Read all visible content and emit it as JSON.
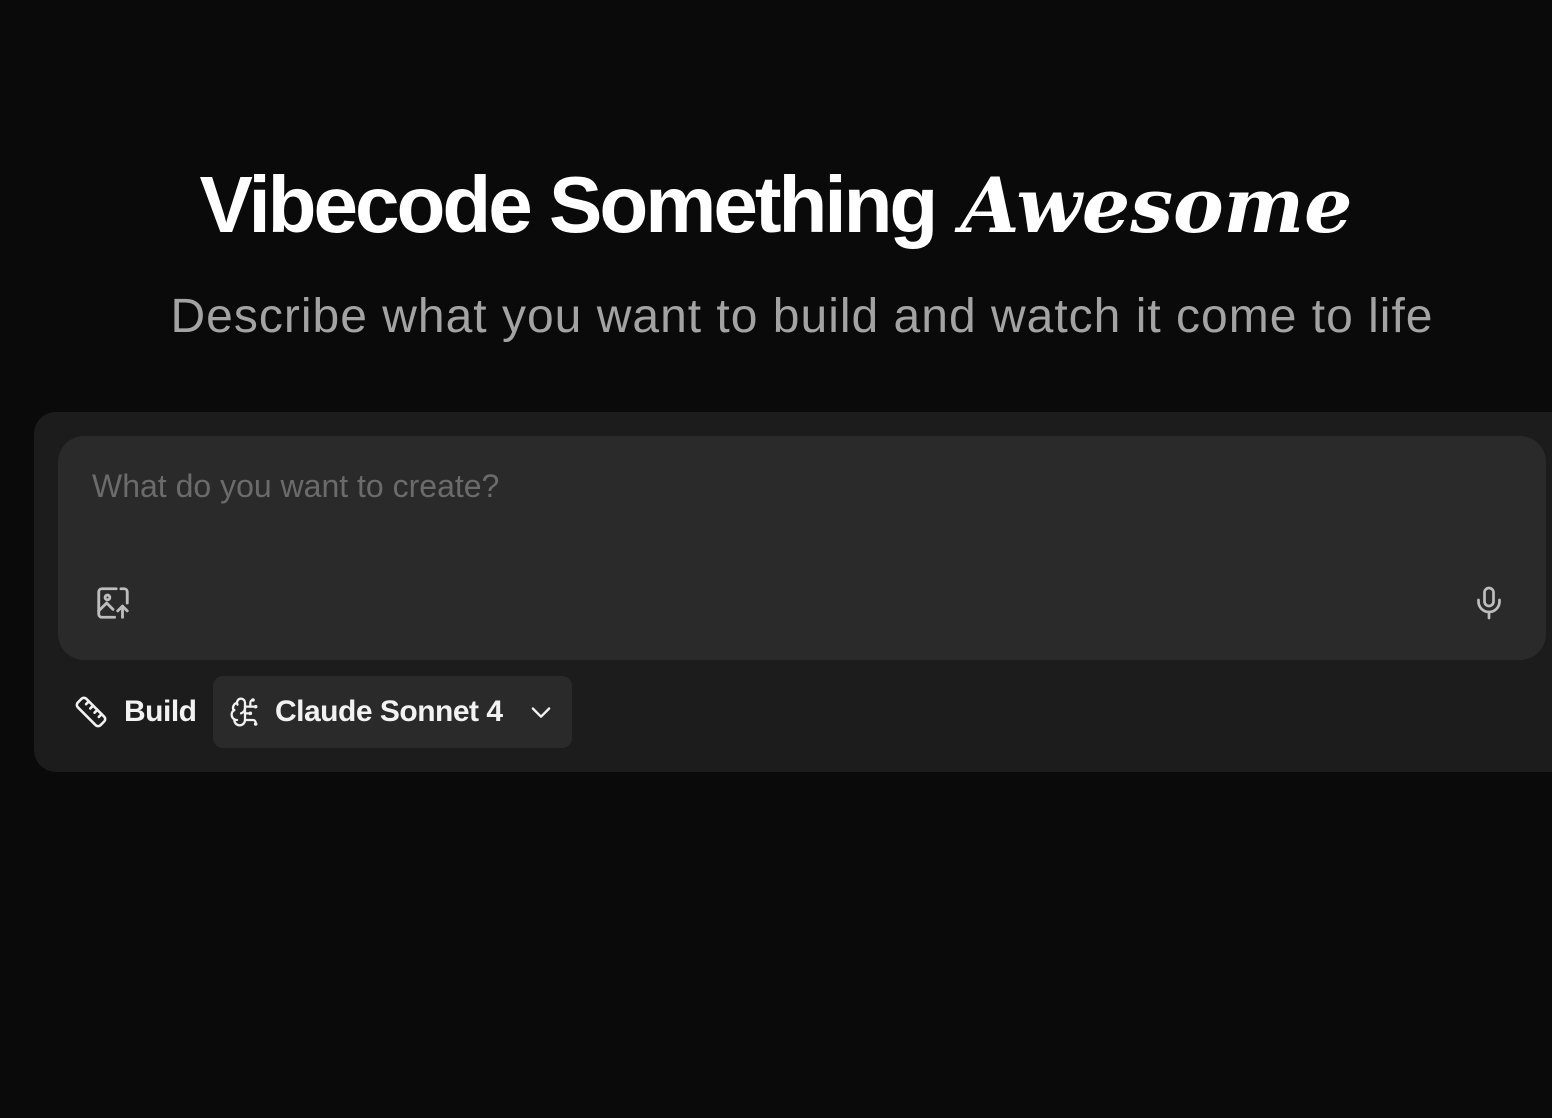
{
  "hero": {
    "title_main": "Vibecode Something",
    "title_accent": "Awesome",
    "subtitle": "Describe what you want to build and watch it come to life"
  },
  "composer": {
    "placeholder": "What do you want to create?",
    "value": "",
    "upload_icon": "image-upload-icon",
    "mic_icon": "microphone-icon"
  },
  "toolbar": {
    "build_label": "Build",
    "build_icon": "ruler-icon",
    "model_label": "Claude Sonnet 4",
    "model_icon": "brain-icon",
    "dropdown_icon": "chevron-down-icon"
  },
  "colors": {
    "background": "#0a0a0a",
    "panel": "#1c1c1c",
    "input": "#2a2a2a",
    "text": "#ffffff",
    "muted": "#a3a3a3",
    "placeholder": "#6b6b6b"
  }
}
